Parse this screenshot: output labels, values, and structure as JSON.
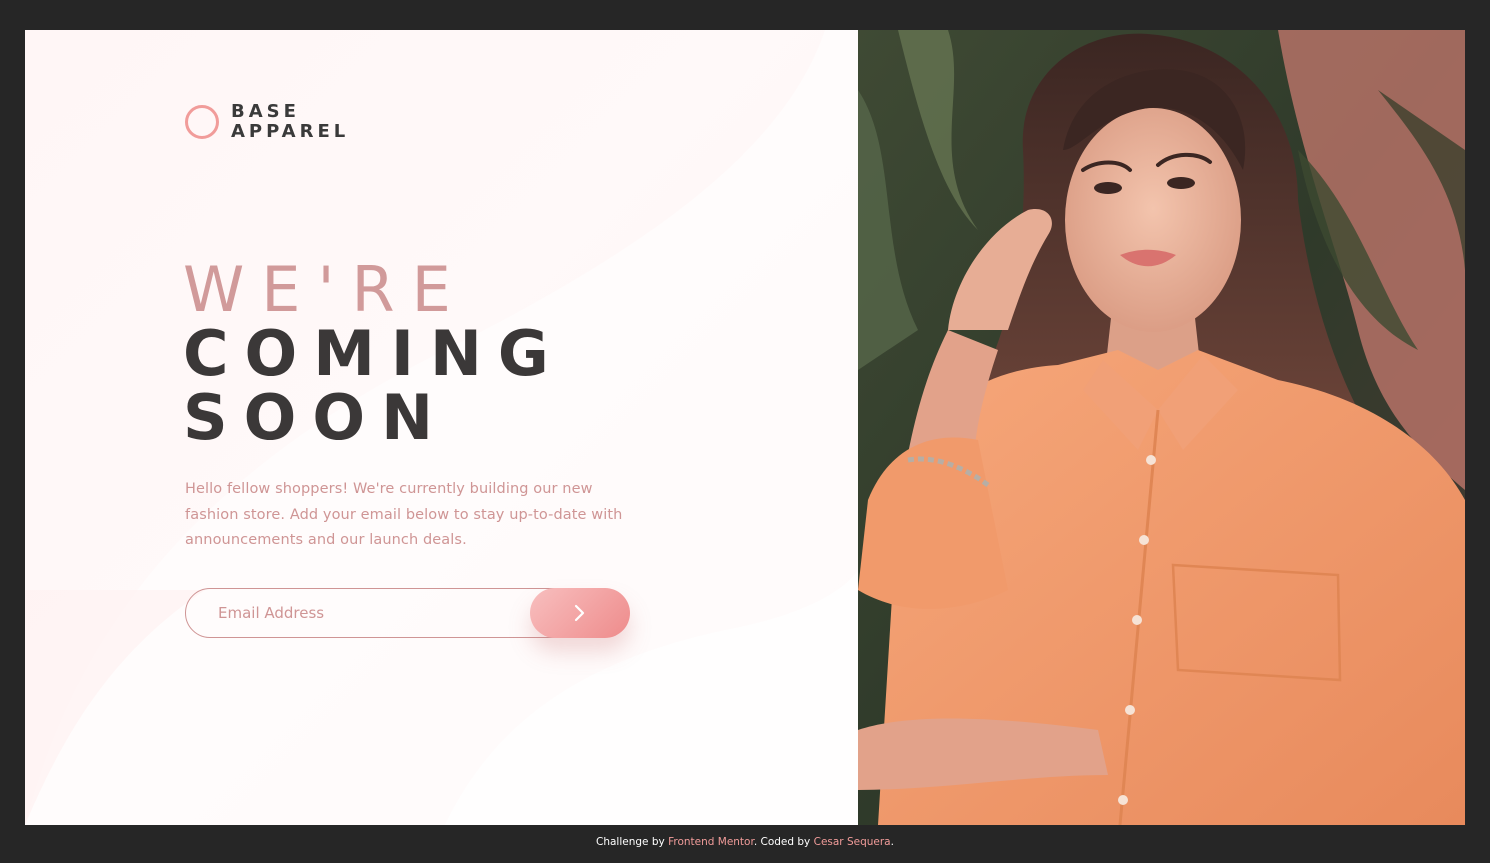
{
  "brand": {
    "line1": "BASE",
    "line2": "APPAREL",
    "logo_icon": "circle-ring-icon",
    "accent": "#f19c9a"
  },
  "hero": {
    "headline_light": "WE'RE",
    "headline_bold_1": "COMING",
    "headline_bold_2": "SOON",
    "description": "Hello fellow shoppers! We're currently building our new fashion store. Add your email below to stay up-to-date with announcements and our launch deals.",
    "image_icon": "model-photo"
  },
  "form": {
    "email_placeholder": "Email Address",
    "submit_icon": "chevron-right-icon"
  },
  "footer": {
    "challenge_prefix": "Challenge by",
    "challenge_link": "Frontend Mentor",
    "coded_prefix": ". Coded by",
    "author_link": "Cesar Sequera",
    "suffix": "."
  },
  "colors": {
    "page_background": "#262626",
    "text_dark": "#3b3838",
    "text_pink": "#cf9595",
    "button_gradient_start": "#f8bfbf",
    "button_gradient_end": "#ee8b8b"
  }
}
